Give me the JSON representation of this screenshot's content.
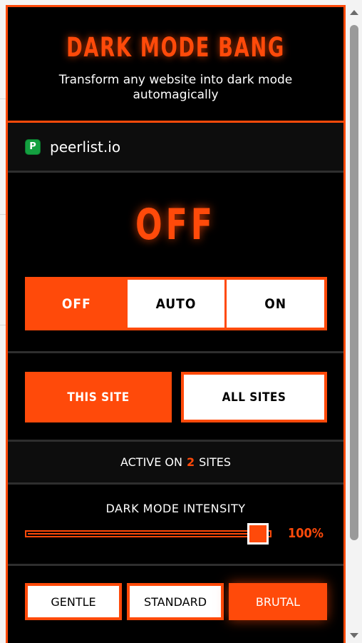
{
  "app": {
    "title": "DARK MODE BANG",
    "subtitle": "Transform any website into dark mode automagically"
  },
  "site": {
    "favicon_letter": "P",
    "name": "peerlist.io"
  },
  "status": {
    "text": "OFF"
  },
  "modes": [
    {
      "label": "OFF",
      "active": true
    },
    {
      "label": "AUTO",
      "active": false
    },
    {
      "label": "ON",
      "active": false
    }
  ],
  "scope": {
    "this_site": "THIS SITE",
    "all_sites": "ALL SITES",
    "selected": "this_site"
  },
  "active": {
    "prefix": "ACTIVE ON",
    "count": "2",
    "suffix": "SITES"
  },
  "intensity": {
    "label": "DARK MODE INTENSITY",
    "value_text": "100%",
    "value": 1.0
  },
  "presets": {
    "gentle": "GENTLE",
    "standard": "STANDARD",
    "brutal": "BRUTAL",
    "selected": "brutal"
  },
  "colors": {
    "accent": "#ff4a0a",
    "background": "#000000",
    "favicon": "#14a040"
  },
  "icons": {
    "favicon": "peerlist-favicon-icon",
    "scroll_up": "chevron-up-icon",
    "scroll_down": "chevron-down-icon"
  }
}
